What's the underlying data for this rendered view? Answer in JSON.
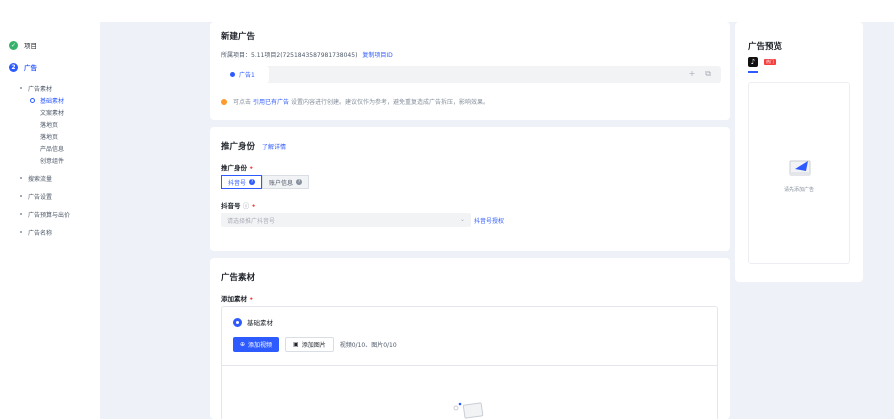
{
  "colors": {
    "accent": "#2e5bff",
    "success": "#34b26a",
    "warning": "#ff9a2e",
    "danger": "#f53f3f"
  },
  "sidebar": {
    "steps": [
      {
        "label": "项目",
        "status": "done",
        "icon": "check-icon"
      },
      {
        "label": "广告",
        "status": "active",
        "index": "2"
      }
    ],
    "groups": [
      {
        "label": "广告素材",
        "children": [
          {
            "label": "基础素材",
            "active": true
          },
          {
            "label": "文案素材"
          },
          {
            "label": "落地页"
          },
          {
            "label": "落地页"
          },
          {
            "label": "产品信息"
          },
          {
            "label": "创意组件"
          }
        ]
      },
      {
        "label": "搜索流量"
      },
      {
        "label": "广告设置"
      },
      {
        "label": "广告预算与出价"
      },
      {
        "label": "广告名称"
      }
    ]
  },
  "new_ad": {
    "title": "新建广告",
    "project_prefix": "所属项目：",
    "project_name": "5.11项目2(7251843587981738045)",
    "copy_id_link": "复制项目ID",
    "tab_label": "广告1",
    "tab_add": "+",
    "tab_copy": "⧉",
    "tip_prefix": "可点击",
    "tip_link": "引用已有广告",
    "tip_suffix": "设置内容进行创建。建议仅作为参考，避免重复造成广告拆压，影响效果。"
  },
  "identity": {
    "title": "推广身份",
    "help_link": "了解详情",
    "field_label": "推广身份",
    "options": [
      {
        "label": "抖音号",
        "selected": true
      },
      {
        "label": "账户信息",
        "selected": false
      }
    ],
    "douyin_label": "抖音号",
    "select_placeholder": "请选择推广抖音号",
    "select_link": "抖音号授权"
  },
  "material": {
    "title": "广告素材",
    "add_label": "添加素材",
    "base_option": "基础素材",
    "add_video": "添加视频",
    "add_image": "添加图片",
    "count": "视频0/10、图片0/10"
  },
  "preview": {
    "title": "广告预览",
    "badge": "热门",
    "tiktok_glyph": "♪",
    "empty_text": "请先添加广告"
  }
}
